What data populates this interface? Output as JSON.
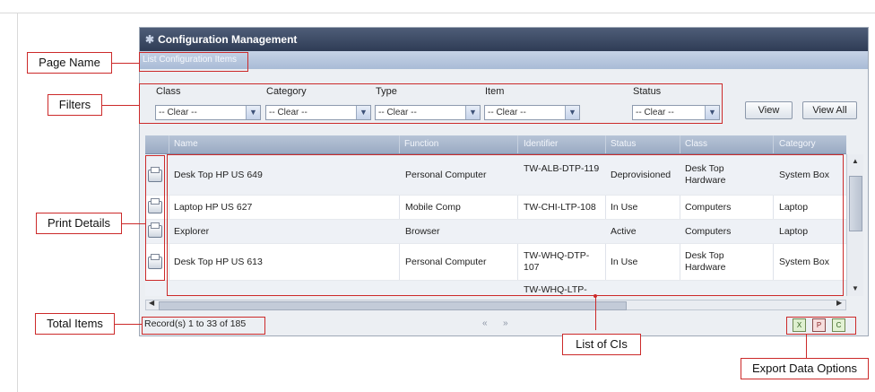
{
  "title": "Configuration Management",
  "title_icon": "wrench-icon",
  "page_name": "List Configuration Items",
  "filters": {
    "labels": [
      "Class",
      "Category",
      "Type",
      "Item",
      "Status"
    ],
    "values": [
      "-- Clear --",
      "-- Clear --",
      "-- Clear --",
      "-- Clear --",
      "-- Clear --"
    ]
  },
  "buttons": {
    "view": "View",
    "view_all": "View All"
  },
  "columns": [
    "Name",
    "Function",
    "Identifier",
    "Status",
    "Class",
    "Category"
  ],
  "rows": [
    {
      "name": "Desk Top HP US 649",
      "function": "Personal Computer",
      "identifier": "TW-ALB-DTP-119",
      "status": "Deprovisioned",
      "class": "Desk Top Hardware",
      "category": "System Box"
    },
    {
      "name": "Laptop HP US 627",
      "function": "Mobile Comp",
      "identifier": "TW-CHI-LTP-108",
      "status": "In Use",
      "class": "Computers",
      "category": "Laptop"
    },
    {
      "name": "Explorer",
      "function": "Browser",
      "identifier": "",
      "status": "Active",
      "class": "Computers",
      "category": "Laptop"
    },
    {
      "name": "Desk Top HP US 613",
      "function": "Personal Computer",
      "identifier": "TW-WHQ-DTP-107",
      "status": "In Use",
      "class": "Desk Top Hardware",
      "category": "System Box"
    },
    {
      "name": "",
      "function": "",
      "identifier": "TW-WHQ-LTP-",
      "status": "",
      "class": "",
      "category": ""
    }
  ],
  "record_text": "Record(s) 1 to 33 of 185",
  "pager": {
    "prev": "«",
    "next": "»"
  },
  "export_icons": [
    "excel-export-icon",
    "pdf-export-icon",
    "csv-export-icon"
  ],
  "callouts": {
    "page_name": "Page Name",
    "filters": "Filters",
    "print_details": "Print Details",
    "total_items": "Total Items",
    "list_of_cis": "List of CIs",
    "export_options": "Export Data Options"
  }
}
